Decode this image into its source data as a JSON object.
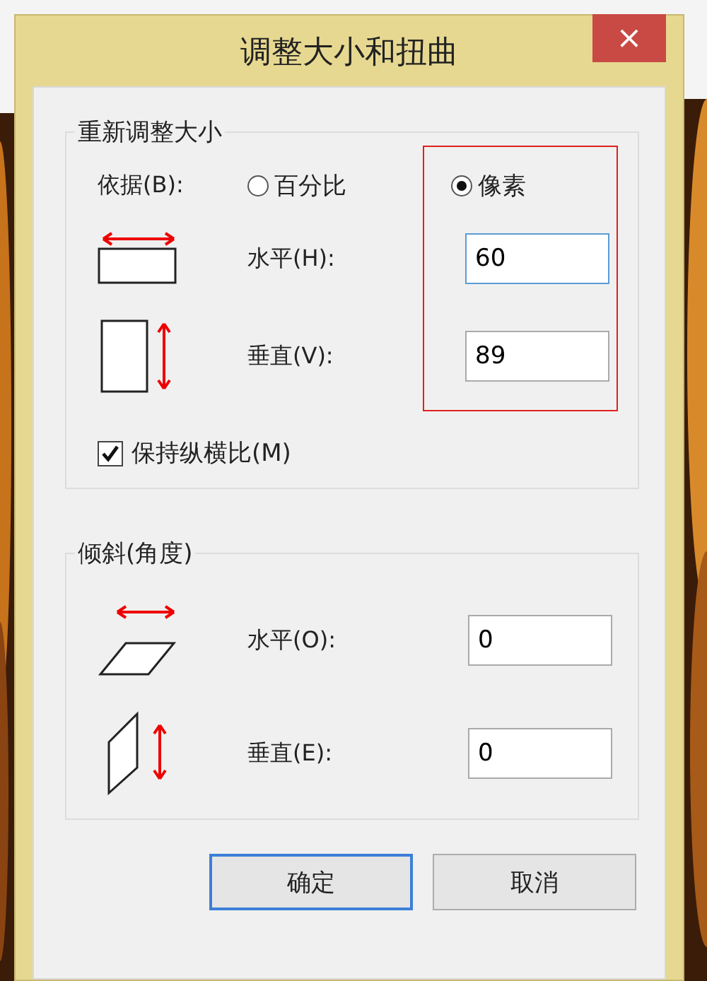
{
  "window": {
    "title": "调整大小和扭曲",
    "close": "×"
  },
  "resize": {
    "legend": "重新调整大小",
    "by_label": "依据(B):",
    "highlighted": true,
    "options": [
      {
        "label": "百分比",
        "selected": false
      },
      {
        "label": "像素",
        "selected": true
      }
    ],
    "fields": [
      {
        "kind": "horizontal",
        "label": "水平(H):",
        "value": "60",
        "focused": true
      },
      {
        "kind": "vertical",
        "label": "垂直(V):",
        "value": "89",
        "focused": false
      }
    ],
    "keep_ratio": {
      "label": "保持纵横比(M)",
      "checked": true
    }
  },
  "skew": {
    "legend": "倾斜(角度)",
    "fields": [
      {
        "kind": "horizontal",
        "label": "水平(O):",
        "value": "0"
      },
      {
        "kind": "vertical",
        "label": "垂直(E):",
        "value": "0"
      }
    ]
  },
  "buttons": [
    {
      "label": "确定",
      "default": true
    },
    {
      "label": "取消",
      "default": false
    }
  ]
}
